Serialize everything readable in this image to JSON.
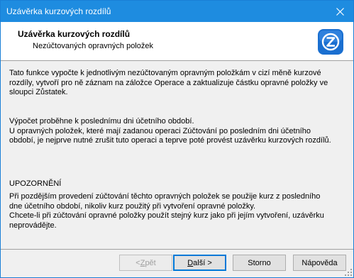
{
  "window": {
    "title": "Uzávěrka kurzových rozdílů"
  },
  "header": {
    "title": "Uzávěrka kurzových rozdílů",
    "subtitle": "Nezúčtovaných opravných položek",
    "logo_icon": "zp-logo-icon"
  },
  "content": {
    "para1_line1": "Tato funkce vypočte k jednotlivým nezúčtovaným opravným položkám v cizí měně kurzové",
    "para1_line2": "rozdíly, vytvoří pro ně záznam na záložce Operace a zaktualizuje částku opravné položky ve",
    "para1_line3": "sloupci Zůstatek.",
    "para2_line1": "Výpočet proběhne k poslednímu dni účetního období.",
    "para2_line2": "U opravných položek, které mají zadanou operaci Zúčtování po posledním dni účetního",
    "para2_line3": "období, je nejprve nutné zrušit tuto operaci a teprve poté provést uzávěrku kurzových rozdílů.",
    "warning_heading": "UPOZORNĚNÍ",
    "para3_line1": "Při pozdějším provedení zúčtování těchto opravných položek se použije kurz z posledního",
    "para3_line2": "dne účetního období, nikoliv kurz použitý při vytvoření opravné položky.",
    "para3_line3": "Chcete-li při zúčtování opravné položky použít stejný kurz jako při jejím vytvoření, uzávěrku",
    "para3_line4": "neprovádějte."
  },
  "buttons": {
    "back_arrow": "< ",
    "back_u": "Z",
    "back_rest": "pět",
    "next_u": "D",
    "next_rest": "alší >",
    "cancel": "Storno",
    "help": "Nápověda"
  },
  "colors": {
    "titlebar": "#1e8ce0",
    "accent": "#0078d7",
    "logo": "#1a6fd0"
  }
}
